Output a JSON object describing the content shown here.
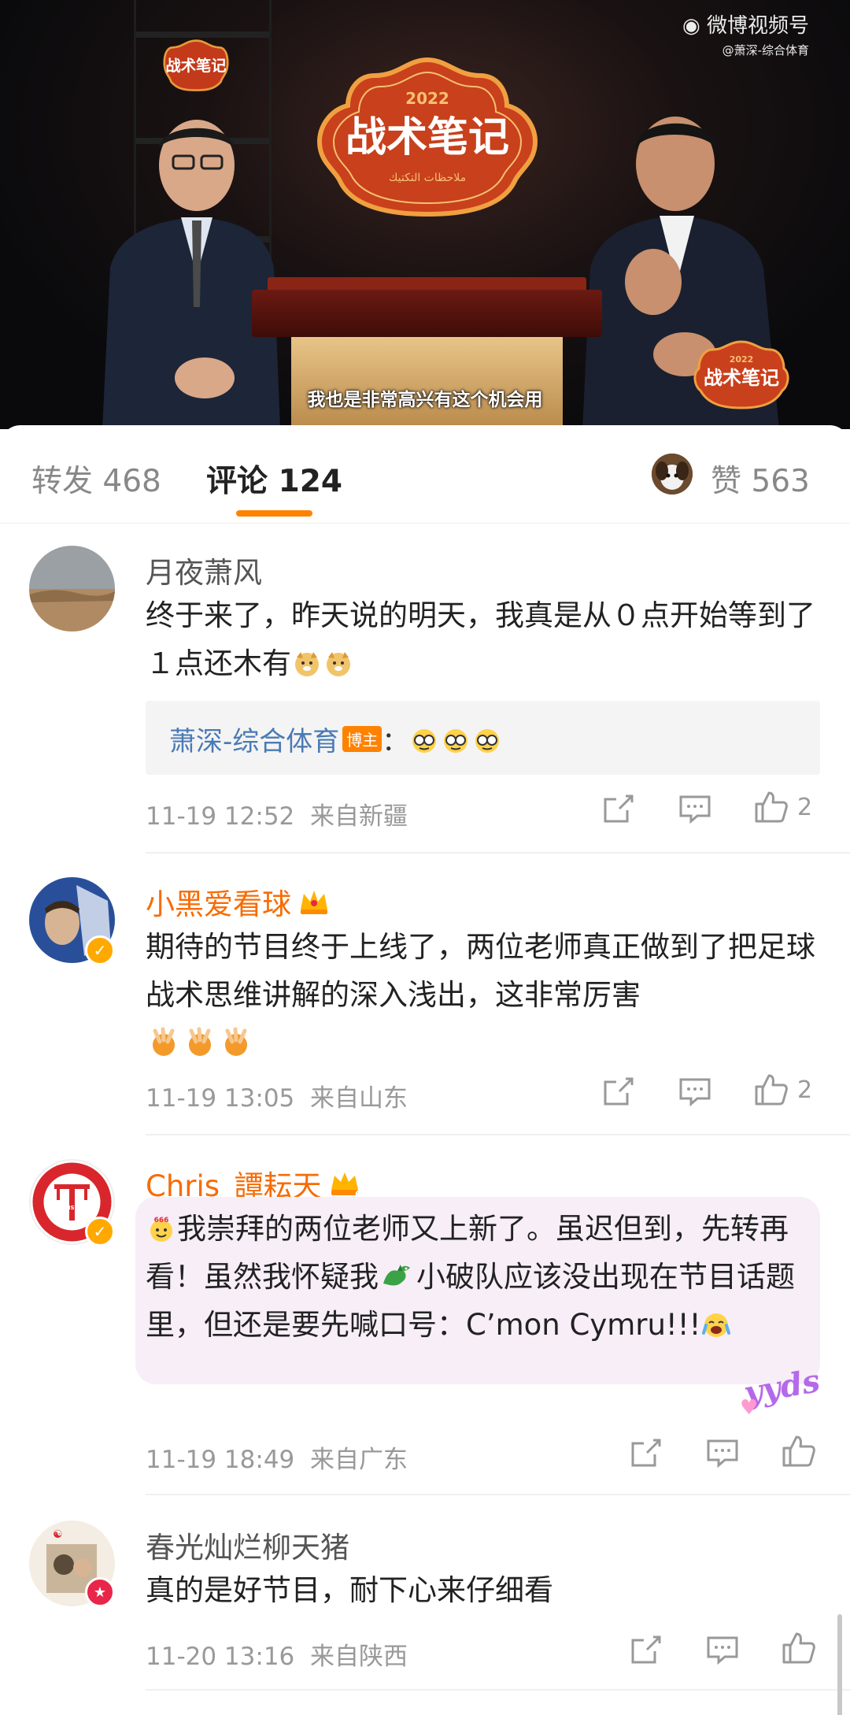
{
  "video": {
    "watermark_title": "微博视频号",
    "watermark_sub": "@萧深-综合体育",
    "show_logo_text": "战术笔记",
    "show_logo_year": "2022",
    "show_logo_arabic": "ملاحظات التكتيك",
    "subtitle": "我也是非常高兴有这个机会用"
  },
  "tabs": {
    "repost_label": "转发",
    "repost_count": "468",
    "comment_label": "评论",
    "comment_count": "124",
    "like_label": "赞",
    "like_count": "563"
  },
  "accent_color": "#ff8200",
  "comments": [
    {
      "name": "月夜萧风",
      "text": "终于来了，昨天说的明天，我真是从０点开始等到了１点还木有",
      "reply_author": "萧深-综合体育",
      "reply_badge": "博主",
      "reply_sep": "：",
      "time": "11-19 12:52",
      "location": "来自新疆",
      "likes": "2"
    },
    {
      "name": "小黑爱看球",
      "text": "期待的节目终于上线了，两位老师真正做到了把足球战术思维讲解的深入浅出，这非常厉害",
      "time": "11-19 13:05",
      "location": "来自山东",
      "likes": "2"
    },
    {
      "name": "Chris_譚耘天",
      "text_a": "我崇拜的两位老师又上新了。虽迟但到，先转再看！虽然我怀疑我",
      "text_b": "小破队应该没出现在节目话题里，但还是要先喊口号：C’mon Cymru!!!",
      "avatar_text": "CHRIS TAN",
      "sticker": "yyds",
      "time": "11-19 18:49",
      "location": "来自广东",
      "likes": ""
    },
    {
      "name": "春光灿烂柳天猪",
      "text": "真的是好节目，耐下心来仔细看",
      "time": "11-20 13:16",
      "location": "来自陕西",
      "likes": ""
    }
  ]
}
